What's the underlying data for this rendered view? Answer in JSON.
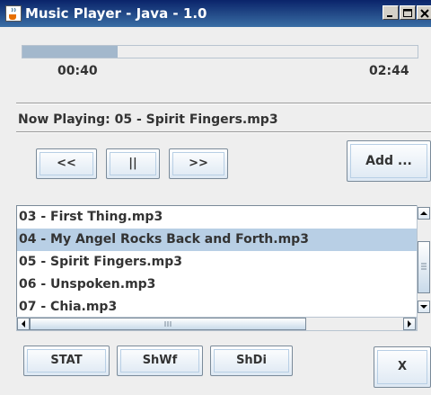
{
  "window": {
    "title": "Music Player - Java - 1.0",
    "controls": [
      "minimize-icon",
      "maximize-icon",
      "close-icon"
    ]
  },
  "progress": {
    "elapsed": "00:40",
    "total": "02:44",
    "fraction": 0.24
  },
  "now_playing": "Now Playing: 05 - Spirit Fingers.mp3",
  "transport": {
    "prev_label": "<<",
    "pause_label": "||",
    "next_label": ">>",
    "add_label": "Add ..."
  },
  "playlist": {
    "items": [
      "03 - First Thing.mp3",
      "04 - My Angel Rocks Back and Forth.mp3",
      "05 - Spirit Fingers.mp3",
      "06 - Unspoken.mp3",
      "07 - Chia.mp3"
    ],
    "selected_index": 1
  },
  "bottom": {
    "stat_label": "STAT",
    "shwf_label": "ShWf",
    "shdi_label": "ShDi",
    "close_label": "X"
  },
  "colors": {
    "titlebar": "#0a246a",
    "selection": "#b8cfe5",
    "progress_fill": "#a3b8cc"
  }
}
